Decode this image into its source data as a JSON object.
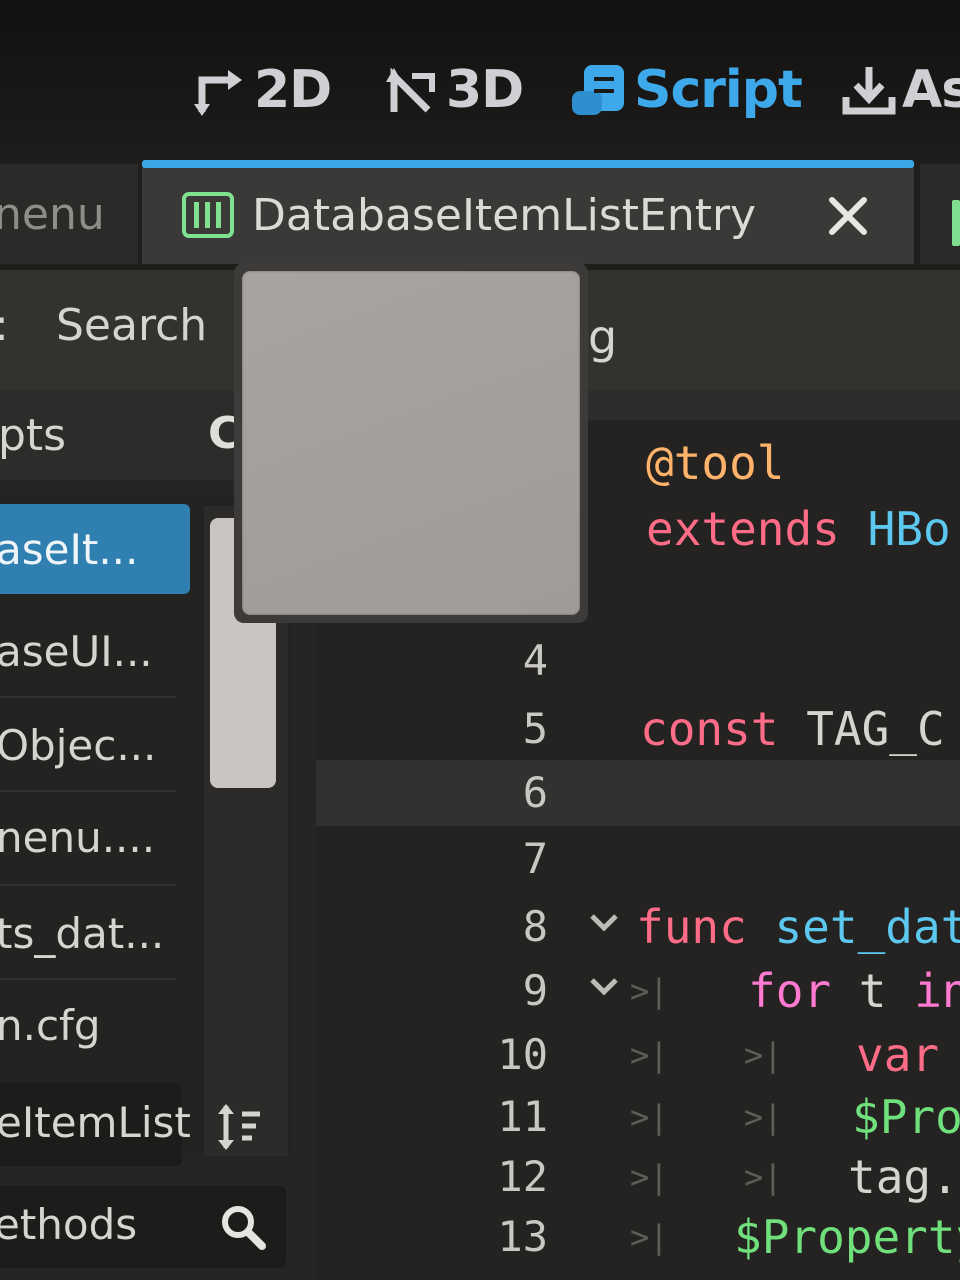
{
  "workspace": {
    "items": [
      {
        "label": "2D",
        "icon": "2d-move-icon"
      },
      {
        "label": "3D",
        "icon": "3d-transform-icon"
      },
      {
        "label": "Script",
        "icon": "script-icon",
        "active": true
      },
      {
        "label": "As",
        "icon": "asset-download-icon"
      }
    ],
    "accent": "#3da9ea"
  },
  "tabs": {
    "prev_label": "nenu",
    "active_label": "DatabaseItemListEntry",
    "active_icon": "grid-scene-icon"
  },
  "menu": {
    "left_fragment": ":",
    "search_label": "Search",
    "right_fragment": "g"
  },
  "left_panel": {
    "header": "pts",
    "header_icon_fragment": "C",
    "files": [
      "aseIt...",
      "aseUI...",
      "Objec...",
      "nenu....",
      "ts_dat...",
      "n.cfg"
    ],
    "selected_index": 0,
    "current_script": "eItemList",
    "methods_filter": "ethods"
  },
  "code": {
    "lines": [
      {
        "num": "",
        "text": "@tool"
      },
      {
        "num": "",
        "text": "extends HBo"
      },
      {
        "num": "4",
        "text": ""
      },
      {
        "num": "5",
        "text": "const TAG_C"
      },
      {
        "num": "6",
        "text": ""
      },
      {
        "num": "7",
        "text": ""
      },
      {
        "num": "8",
        "text": "func set_dat"
      },
      {
        "num": "9",
        "text": "for t in"
      },
      {
        "num": "10",
        "text": "var"
      },
      {
        "num": "11",
        "text": "$Pro"
      },
      {
        "num": "12",
        "text": "tag."
      },
      {
        "num": "13",
        "text": "$Property"
      }
    ]
  },
  "colors": {
    "keyword": "#ff6c87",
    "annotation": "#ffb36b",
    "function": "#5cc8f0",
    "node_path": "#6fe07c",
    "selection": "#2f7fb0"
  }
}
